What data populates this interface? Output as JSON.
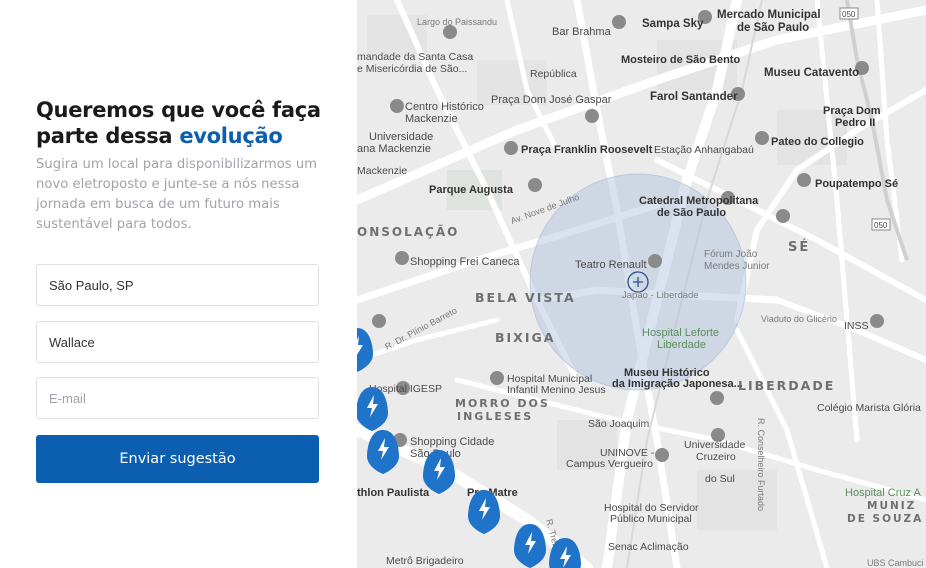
{
  "form": {
    "headline_part1": "Queremos que você faça parte dessa ",
    "headline_accent": "evolução",
    "subtitle": "Sugira um local para disponibilizarmos um novo eletroposto e junte-se a nós nessa jornada em busca de um futuro mais sustentável para todos.",
    "city_value": "São Paulo, SP",
    "name_value": "Wallace",
    "email_placeholder": "E-mail",
    "submit_label": "Enviar sugestão",
    "accent_color": "#0c5eb0"
  },
  "map": {
    "pins_icon": "lightning-bolt-icon",
    "labels": {
      "largo_paissandu": "Largo do Paissandu",
      "sampa_sky": "Sampa Sky",
      "mercado": "Mercado Municipal",
      "mercado2": "de São Paulo",
      "bar_brahma": "Bar Brahma",
      "santa_casa": "mandade da Santa Casa",
      "santa_casa2": "e Misericórdia de São...",
      "republica": "República",
      "mosteiro": "Mosteiro de São Bento",
      "museu_catavento": "Museu Catavento",
      "centro_historico": "Centro Histórico",
      "mackenzie": "Mackenzie",
      "praca_dom_jose": "Praça Dom José Gaspar",
      "farol": "Farol Santander",
      "praca_dom": "Praça Dom",
      "pedro": "Pedro II",
      "universidade": "Universidade",
      "presb_mackenzie": "ana Mackenzie",
      "praca_franklin": "Praça Franklin Roosevelt",
      "anhangabau": "Estação Anhangabaú",
      "pateo": "Pateo do Collegio",
      "mackenzie_station": "Mackenzie",
      "parque_augusta": "Parque Augusta",
      "catedral": "Catedral Metropolitana",
      "catedral2": "de São Paulo",
      "poupatempo": "Poupatempo Sé",
      "av_nove": "Av. Nove de Julho",
      "consolacao": "ONSOLAÇÃO",
      "shopping_frei": "Shopping Frei Caneca",
      "teatro": "Teatro Renault",
      "forum": "Fórum João",
      "forum2": "Mendes Junior",
      "se": "SÉ",
      "bela_vista": "BELA VISTA",
      "japao": "Japão - Liberdade",
      "bixiga": "BIXIGA",
      "hospital_leforte": "Hospital Leforte",
      "hospital_leforte2": "Liberdade",
      "viaduto": "Viaduto do Glicério",
      "inss": "INSS",
      "r_plinio": "R. Dr. Plínio Barreto",
      "hospital_pediatria": "Hospital Municipal",
      "hospital_pediatria2": "Infantil Menino Jesus",
      "museu_imigracao": "Museu Histórico",
      "museu_imigracao2": "da Imigração Japonesa...",
      "liberdade": "LIBERDADE",
      "hospital_igesp": "Hospital IGESP",
      "morro": "MORRO DOS",
      "ingleses": "INGLESES",
      "colegio": "Colégio Marista Glória",
      "shopping_cidade": "Shopping Cidade",
      "shopping_cidade2": "São Paulo",
      "sao_joaquim": "São Joaquim",
      "uninove": "UNINOVE -",
      "campus": "Campus Vergueiro",
      "cruzeiro": "Universidade",
      "cruzeiro2": "Cruzeiro",
      "cruzeiro3": "do Sul",
      "athlon": "thlon Paulista",
      "pro_matre": "Pro Matre",
      "hospital_servidor": "Hospital do Servidor",
      "hospital_servidor2": "Público Municipal",
      "hospital_cruz": "Hospital Cruz A",
      "muniz": "MUNIZ",
      "souza": "DE SOUZA",
      "metro_brigadeiro": "Metrô Brigadeiro",
      "senac": "Senac Aclimação",
      "r_conselheiro": "R. Conselheiro Furtado",
      "r_treze": "R. Treze de Maio",
      "ubs": "UBS Cambuci",
      "hwy1": "050",
      "hwy2": "050"
    }
  }
}
